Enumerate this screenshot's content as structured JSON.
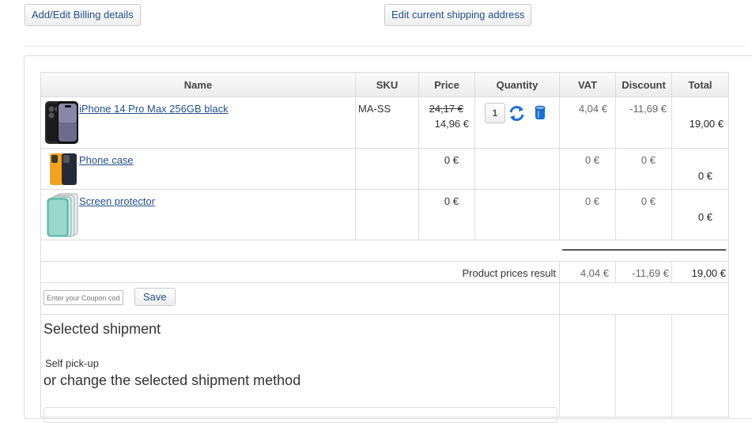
{
  "top_buttons": {
    "billing": "Add/Edit Billing details",
    "shipping": "Edit current shipping address"
  },
  "table": {
    "headers": [
      "Name",
      "SKU",
      "Price",
      "Quantity",
      "VAT",
      "Discount",
      "Total"
    ],
    "rows": [
      {
        "name": "iPhone 14 Pro Max 256GB black",
        "sku": "MA-SS",
        "price_old": "24,17 €",
        "price": "14,96 €",
        "quantity": "1",
        "vat": "4,04 €",
        "discount": "-11,69 €",
        "total": "19,00 €",
        "image_icon": "phone-image-icon"
      },
      {
        "name": "Phone case",
        "sku": "",
        "price": "0 €",
        "vat": "0 €",
        "discount": "0 €",
        "total": "0 €",
        "image_icon": "phone-case-image-icon"
      },
      {
        "name": "Screen protector",
        "sku": "",
        "price": "0 €",
        "vat": "0 €",
        "discount": "0 €",
        "total": "0 €",
        "image_icon": "screen-protector-image-icon"
      }
    ],
    "result": {
      "label": "Product prices result",
      "vat": "4,04 €",
      "discount": "-11,69 €",
      "total": "19,00 €"
    }
  },
  "coupon": {
    "placeholder": "Enter your Coupon code",
    "save_label": "Save"
  },
  "shipment": {
    "title": "Selected shipment",
    "method": "Self pick-up",
    "change_label": "or change the selected shipment method"
  },
  "icons": {
    "update_quantity": "refresh-icon",
    "delete_item": "trash-icon"
  },
  "colors": {
    "link": "#1f4f8c",
    "icon_blue": "#1a6fd6"
  }
}
